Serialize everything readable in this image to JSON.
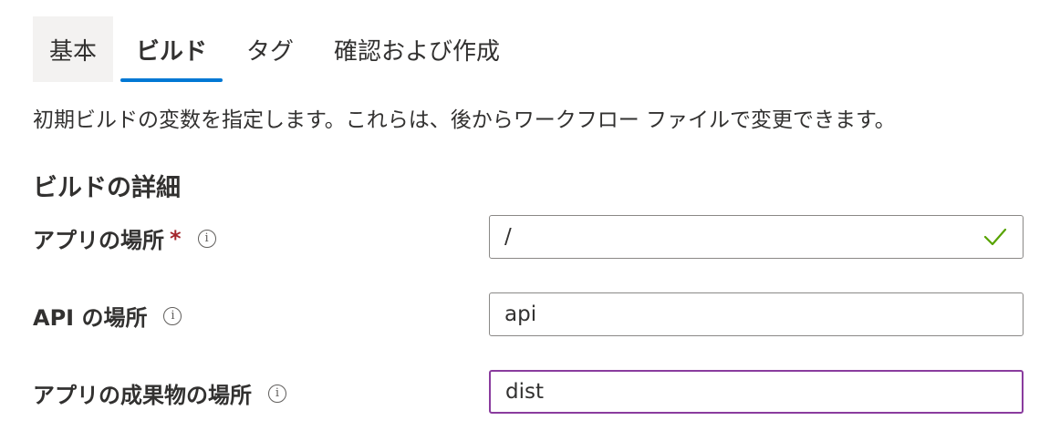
{
  "tabs": [
    {
      "label": "基本",
      "active": false
    },
    {
      "label": "ビルド",
      "active": true
    },
    {
      "label": "タグ",
      "active": false
    },
    {
      "label": "確認および作成",
      "active": false
    }
  ],
  "description": "初期ビルドの変数を指定します。これらは、後からワークフロー ファイルで変更できます。",
  "section_title": "ビルドの詳細",
  "fields": {
    "app_location": {
      "label": "アプリの場所",
      "required_mark": "*",
      "value": "/",
      "valid": true
    },
    "api_location": {
      "label": "API の場所",
      "value": "api"
    },
    "output_location": {
      "label": "アプリの成果物の場所",
      "value": "dist",
      "focused": true
    }
  },
  "icons": {
    "info": "info-icon",
    "valid": "checkmark-icon"
  },
  "colors": {
    "accent": "#0078d4",
    "required": "#a4262c",
    "valid": "#57a300",
    "focus_border": "#8a3c9e",
    "tab_hover_bg": "#f3f2f1"
  }
}
